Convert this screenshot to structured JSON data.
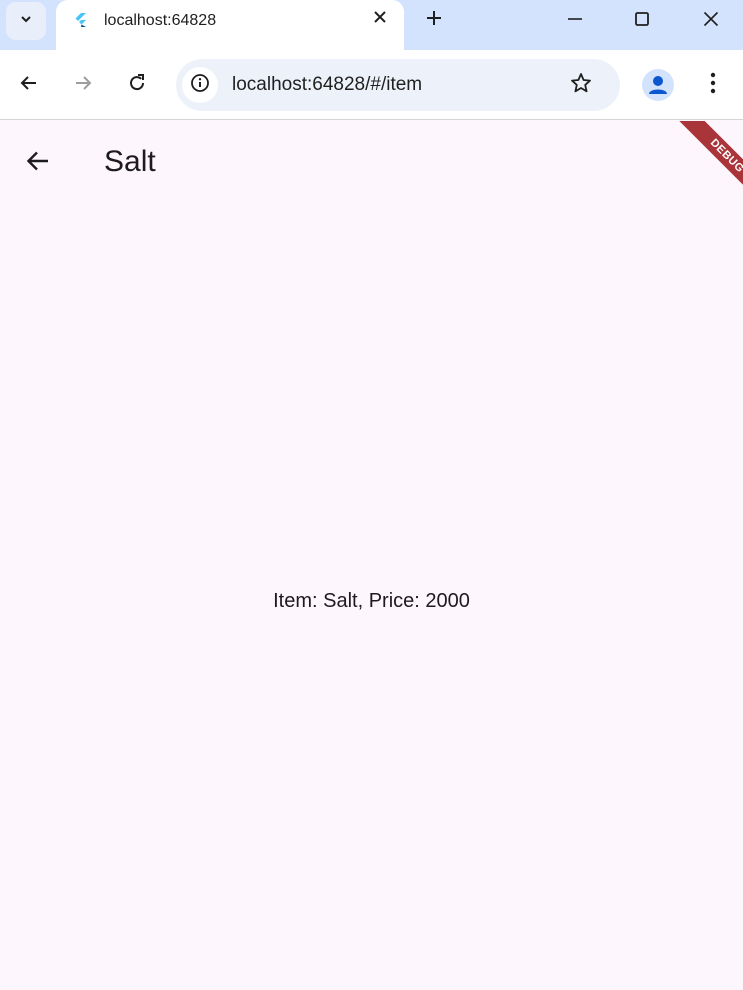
{
  "browser": {
    "tab": {
      "title": "localhost:64828"
    },
    "address": {
      "url": "localhost:64828/#/item"
    }
  },
  "app": {
    "title": "Salt",
    "item_text": "Item: Salt, Price: 2000",
    "debug_label": "DEBUG"
  },
  "icons": {
    "tab_search": "chevron-down-icon",
    "favicon": "flutter-icon",
    "close": "close-icon",
    "new_tab": "plus-icon",
    "back": "arrow-left-icon",
    "forward": "arrow-right-icon",
    "reload": "reload-icon",
    "site_info": "info-icon",
    "bookmark": "star-icon",
    "profile": "person-icon",
    "menu": "kebab-icon"
  },
  "colors": {
    "tab_strip": "#d3e3fd",
    "page_background": "#fdf6fd",
    "debug_banner": "#a9353b"
  }
}
